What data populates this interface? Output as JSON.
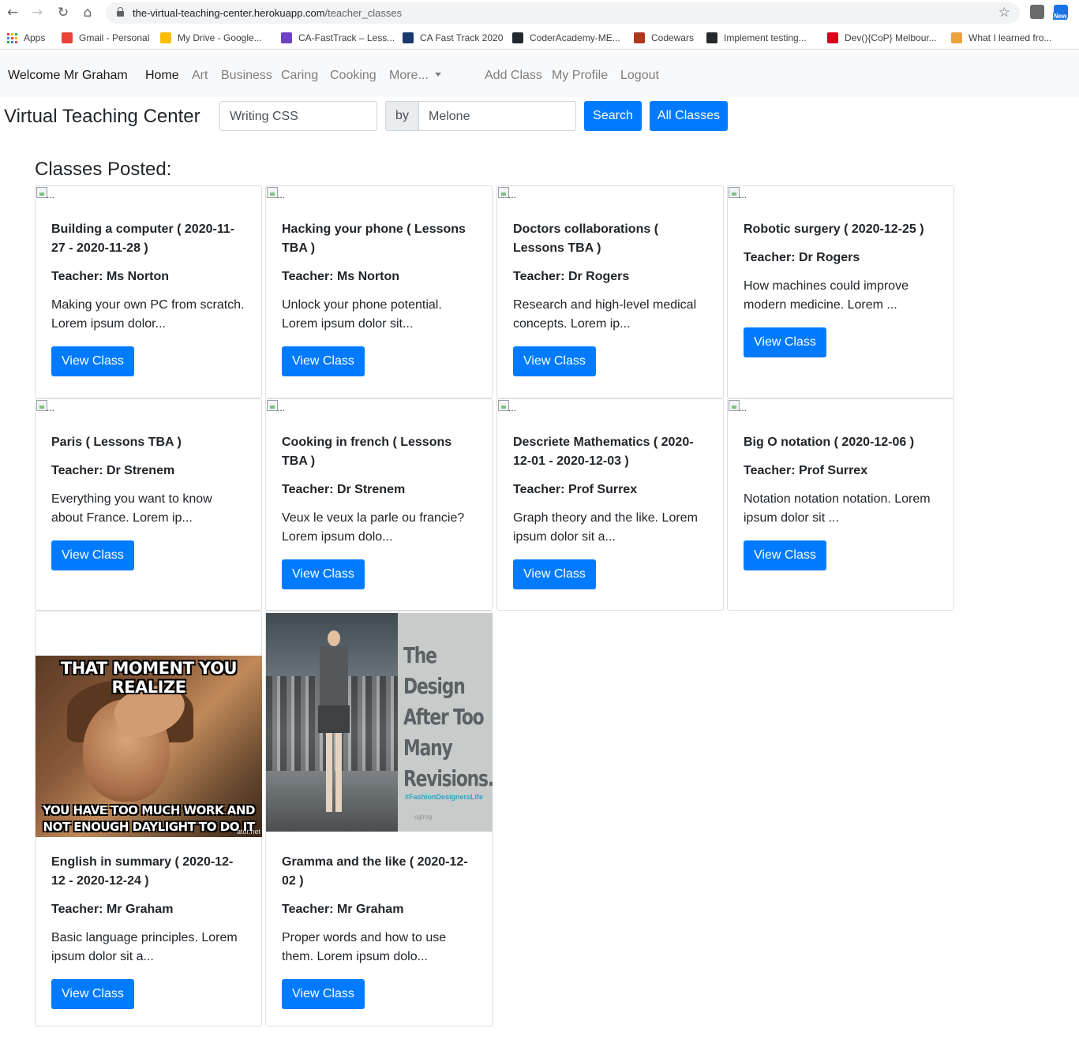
{
  "browser": {
    "url_host": "the-virtual-teaching-center.herokuapp.com",
    "url_path": "/teacher_classes",
    "bookmarks": [
      {
        "label": "Apps",
        "color": "#4285f4"
      },
      {
        "label": "Gmail - Personal",
        "color": "#ea4335"
      },
      {
        "label": "My Drive - Google...",
        "color": "#fbbc04"
      },
      {
        "label": "CA-FastTrack – Less...",
        "color": "#6f42c1"
      },
      {
        "label": "CA Fast Track 2020",
        "color": "#1a3a6e"
      },
      {
        "label": "CoderAcademy-ME...",
        "color": "#24292e"
      },
      {
        "label": "Codewars",
        "color": "#b1361e"
      },
      {
        "label": "Implement testing...",
        "color": "#24292e"
      },
      {
        "label": "Dev(){CoP} Melbour...",
        "color": "#d6001c"
      },
      {
        "label": "What I learned fro...",
        "color": "#e8a33d"
      }
    ],
    "ext_badge": "New"
  },
  "navbar": {
    "welcome": "Welcome Mr Graham",
    "links": [
      "Home",
      "Art",
      "Business",
      "Caring",
      "Cooking",
      "More...",
      "Add Class",
      "My Profile",
      "Logout"
    ]
  },
  "search": {
    "brand": "Virtual Teaching Center",
    "class_value": "Writing CSS",
    "by_label": "by",
    "teacher_value": "Melone",
    "search_button": "Search",
    "all_button": "All Classes"
  },
  "heading": "Classes Posted:",
  "img_alt": "...",
  "view_button": "View Class",
  "cards": [
    {
      "title": "Building a computer ( 2020-11-27 - 2020-11-28 )",
      "teacher": "Teacher: Ms Norton",
      "desc": "Making your own PC from scratch. Lorem ipsum dolor..."
    },
    {
      "title": "Hacking your phone ( Lessons TBA )",
      "teacher": "Teacher: Ms Norton",
      "desc": "Unlock your phone potential. Lorem ipsum dolor sit..."
    },
    {
      "title": "Doctors collaborations ( Lessons TBA )",
      "teacher": "Teacher: Dr Rogers",
      "desc": "Research and high-level medical concepts. Lorem ip..."
    },
    {
      "title": "Robotic surgery ( 2020-12-25 )",
      "teacher": "Teacher: Dr Rogers",
      "desc": "How machines could improve modern medicine. Lorem ..."
    },
    {
      "title": "Paris ( Lessons TBA )",
      "teacher": "Teacher: Dr Strenem",
      "desc": "Everything you want to know about France. Lorem ip..."
    },
    {
      "title": "Cooking in french ( Lessons TBA )",
      "teacher": "Teacher: Dr Strenem",
      "desc": "Veux le veux la parle ou francie? Lorem ipsum dolo..."
    },
    {
      "title": "Descriete Mathematics ( 2020-12-01 - 2020-12-03 )",
      "teacher": "Teacher: Prof Surrex",
      "desc": "Graph theory and the like. Lorem ipsum dolor sit a..."
    },
    {
      "title": "Big O notation ( 2020-12-06 )",
      "teacher": "Teacher: Prof Surrex",
      "desc": "Notation notation notation. Lorem ipsum dolor sit ..."
    },
    {
      "title": "English in summary ( 2020-12-12 - 2020-12-24 )",
      "teacher": "Teacher: Mr Graham",
      "desc": "Basic language principles. Lorem ipsum dolor sit a..."
    },
    {
      "title": "Gramma and the like ( 2020-12-02 )",
      "teacher": "Teacher: Mr Graham",
      "desc": "Proper words and how to use them. Lorem ipsum dolo..."
    }
  ],
  "memes": {
    "moment_top": "THAT MOMENT YOU REALIZE",
    "moment_bottom": "YOU HAVE TOO MUCH WORK AND NOT ENOUGH DAYLIGHT TO DO IT IN",
    "moment_watermark": "ator.net",
    "design_title": "The Design After Too Many Revisions...",
    "design_tag": "#FashionDesignersLife",
    "design_watermark": "cgfrog"
  }
}
